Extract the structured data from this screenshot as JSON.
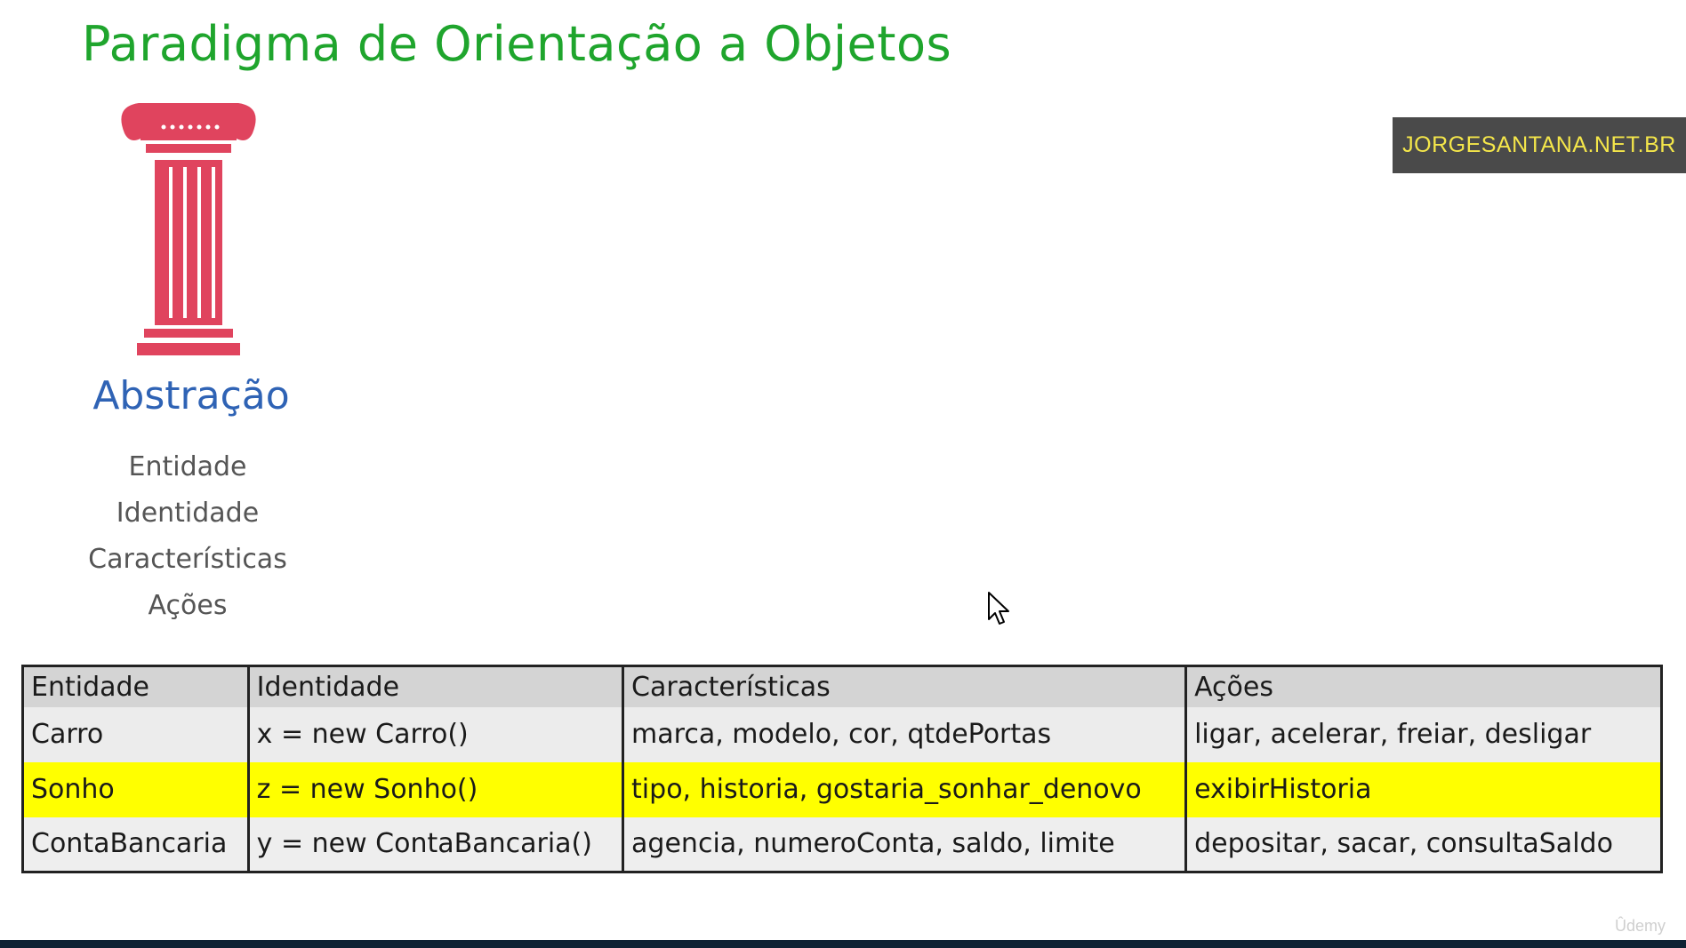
{
  "slide": {
    "title": "Paradigma de Orientação a Objetos",
    "watermark": "JORGESANTANA.NET.BR",
    "pillar_title": "Abstração",
    "pillar_icon": "pillar-icon",
    "concepts": [
      "Entidade",
      "Identidade",
      "Características",
      "Ações"
    ]
  },
  "table": {
    "headers": [
      "Entidade",
      "Identidade",
      "Características",
      "Ações"
    ],
    "rows": [
      [
        "Carro",
        "x = new Carro()",
        "marca, modelo, cor, qtdePortas",
        "ligar, acelerar, freiar, desligar"
      ],
      [
        "Sonho",
        "z = new Sonho()",
        "tipo, historia, gostaria_sonhar_denovo",
        "exibirHistoria"
      ],
      [
        "ContaBancaria",
        "y = new ContaBancaria()",
        "agencia, numeroConta, saldo, limite",
        "depositar, sacar, consultaSaldo"
      ]
    ],
    "highlighted_row": 1
  },
  "colors": {
    "title": "#1fa52d",
    "pillar": "#e0445e",
    "pillar_title": "#2f63b5",
    "highlight": "#ffff00",
    "watermark_bg": "#4a4a4a",
    "watermark_text": "#f4e64a"
  },
  "footer": {
    "brand": "Ûdemy"
  }
}
